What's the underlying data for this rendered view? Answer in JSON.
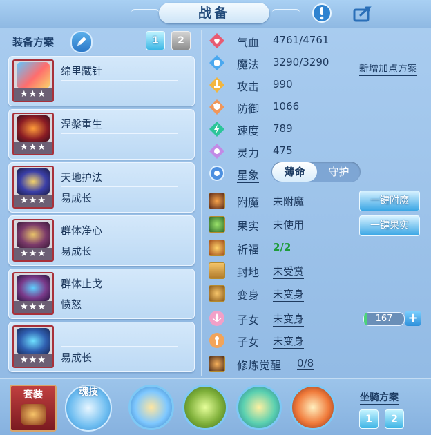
{
  "header": {
    "title": "战备"
  },
  "equip": {
    "label": "装备方案",
    "tabs": [
      "1",
      "2"
    ],
    "items": [
      {
        "name": "绵里藏针",
        "sub": "",
        "stars": "★★★"
      },
      {
        "name": "涅槃重生",
        "sub": "",
        "stars": "★★★"
      },
      {
        "name": "天地护法",
        "sub": "易成长",
        "stars": "★★★"
      },
      {
        "name": "群体净心",
        "sub": "易成长",
        "stars": "★★★"
      },
      {
        "name": "群体止戈",
        "sub": "愤怒",
        "stars": "★★★"
      },
      {
        "name": "",
        "sub": "易成长",
        "stars": "★★★"
      }
    ]
  },
  "stats": {
    "add_plan": "新增加点方案",
    "rows": [
      {
        "label": "气血",
        "value": "4761/4761"
      },
      {
        "label": "魔法",
        "value": "3290/3290"
      },
      {
        "label": "攻击",
        "value": "990"
      },
      {
        "label": "防御",
        "value": "1066"
      },
      {
        "label": "速度",
        "value": "789"
      },
      {
        "label": "灵力",
        "value": "475"
      }
    ],
    "star_label": "星象",
    "star_options": [
      "薄命",
      "守护"
    ]
  },
  "extras": {
    "rows": [
      {
        "label": "附魔",
        "value": "未附魔"
      },
      {
        "label": "果实",
        "value": "未使用"
      },
      {
        "label": "祈福",
        "value": "2/2"
      },
      {
        "label": "封地",
        "value": "未受赏"
      },
      {
        "label": "变身",
        "value": "未变身"
      },
      {
        "label": "子女",
        "value": "未变身"
      },
      {
        "label": "子女",
        "value": "未变身"
      },
      {
        "label": "修炼觉醒",
        "value": "0/8"
      }
    ],
    "btn_enchant": "一键附魔",
    "btn_fruit": "一键果实",
    "child_value": "167",
    "plus": "+"
  },
  "bottom": {
    "set_label": "套装",
    "soul_label": "魂技",
    "mount_label": "坐骑方案",
    "mount_tabs": [
      "1",
      "2"
    ]
  },
  "colors": {
    "panel": "#a7cbef",
    "accent_blue": "#3aa6e5",
    "green_value": "#1e9c3b",
    "card_border_red": "#a8313a"
  }
}
